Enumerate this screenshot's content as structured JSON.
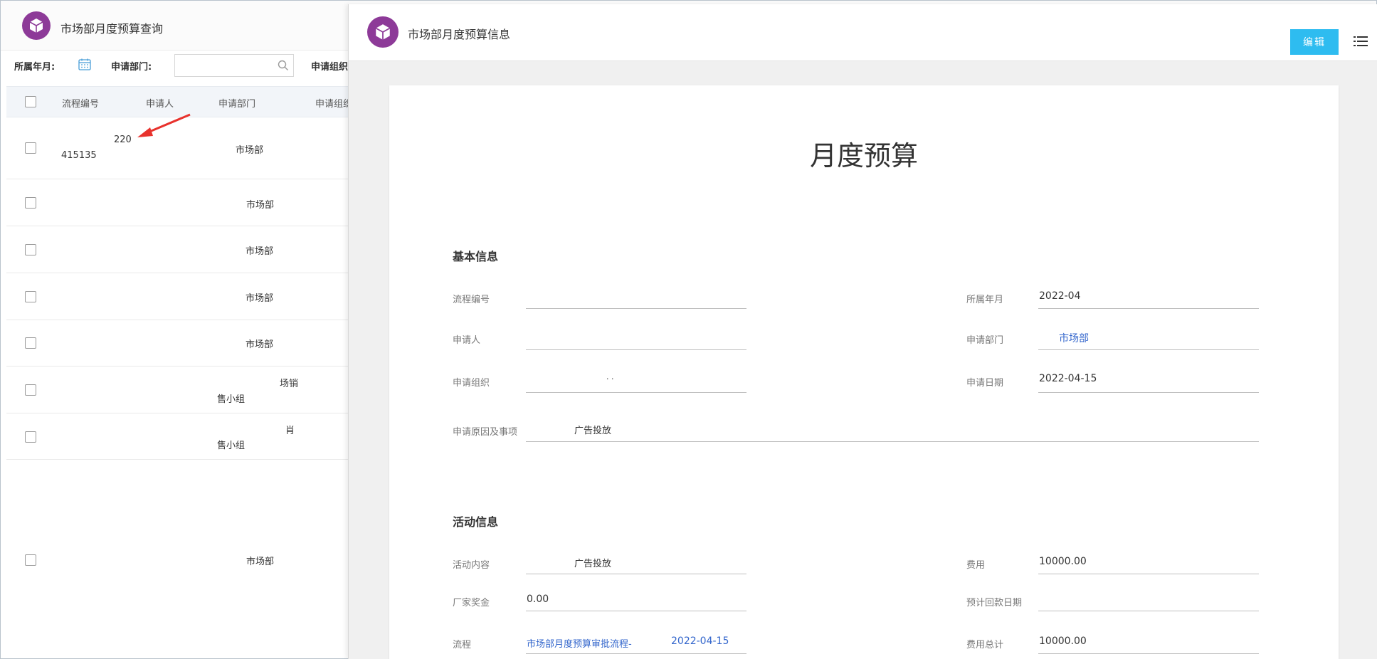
{
  "list": {
    "title": "市场部月度预算查询",
    "filters": {
      "year_month_label": "所属年月:",
      "department_label": "申请部门:",
      "organization_label": "申请组织"
    },
    "columns": [
      "流程编号",
      "申请人",
      "申请部门",
      "申请组织"
    ],
    "rows": [
      {
        "process_no_line1": "220",
        "process_no_line2": "415135",
        "department": "市场部",
        "org": "",
        "extra": ""
      },
      {
        "process_no_line1": "",
        "process_no_line2": "",
        "department": "市场部",
        "org": "",
        "extra": ""
      },
      {
        "process_no_line1": "",
        "process_no_line2": "",
        "department": "市场部",
        "org": "",
        "extra": ""
      },
      {
        "process_no_line1": "",
        "process_no_line2": "",
        "department": "市场部",
        "org": "",
        "extra": ""
      },
      {
        "process_no_line1": "",
        "process_no_line2": "",
        "department": "市场部",
        "org": "",
        "extra": ""
      },
      {
        "process_no_line1": "",
        "process_no_line2": "",
        "department": "售小组",
        "org": "场销",
        "extra": ""
      },
      {
        "process_no_line1": "",
        "process_no_line2": "",
        "department": "售小组",
        "org": "肖",
        "extra": ""
      },
      {
        "process_no_line1": "",
        "process_no_line2": "",
        "department": "市场部",
        "org": "",
        "extra": ""
      }
    ]
  },
  "drawer": {
    "title": "市场部月度预算信息",
    "edit_label": "编辑",
    "form_title": "月度预算",
    "basic_section": "基本信息",
    "activity_section": "活动信息",
    "fields": {
      "process_no": {
        "label": "流程编号",
        "value": ""
      },
      "year_month": {
        "label": "所属年月",
        "value": "2022-04"
      },
      "applicant": {
        "label": "申请人",
        "value": ""
      },
      "department": {
        "label": "申请部门",
        "value": "市场部"
      },
      "organization": {
        "label": "申请组织",
        "value": ". ."
      },
      "apply_date": {
        "label": "申请日期",
        "value": "2022-04-15"
      },
      "reason": {
        "label": "申请原因及事项",
        "value": "广告投放"
      },
      "activity_content": {
        "label": "活动内容",
        "value": "广告投放"
      },
      "cost": {
        "label": "费用",
        "value": "10000.00"
      },
      "vendor_bonus": {
        "label": "厂家奖金",
        "value": "0.00"
      },
      "expected_return_date": {
        "label": "预计回款日期",
        "value": ""
      },
      "flow": {
        "label": "流程",
        "value": "市场部月度预算审批流程-",
        "date": "2022-04-15"
      },
      "cost_total": {
        "label": "费用总计",
        "value": "10000.00"
      }
    }
  },
  "colors": {
    "brand": "#8d3a98",
    "edit_button": "#2ebcf0",
    "link": "#3366cc",
    "annotation_arrow": "#e8322d"
  }
}
